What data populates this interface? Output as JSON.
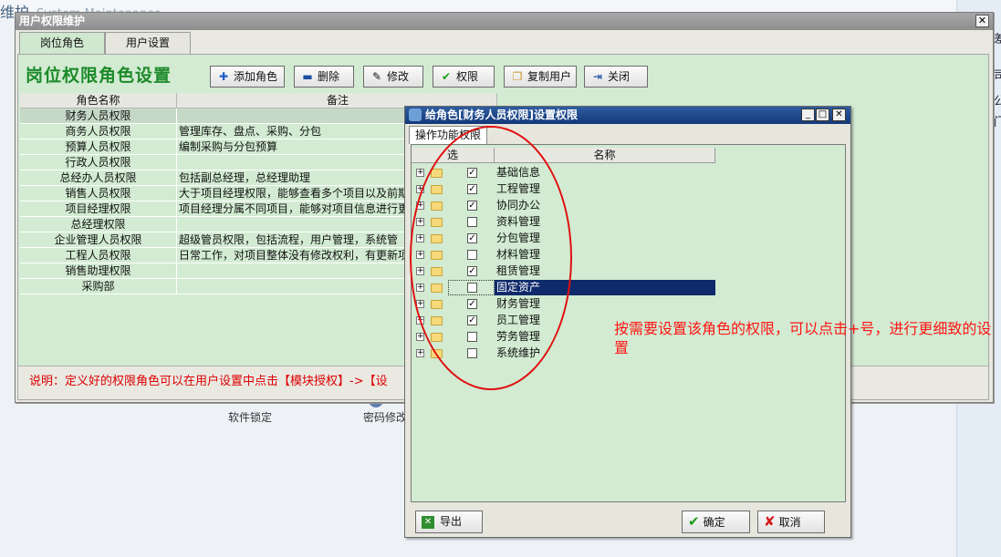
{
  "background": {
    "title": "维护",
    "subtitle": "System Maintenance",
    "links": [
      "软件锁定",
      "密码修改"
    ],
    "right_fragments": [
      "差",
      "司",
      "公",
      "门"
    ]
  },
  "main_window": {
    "title": "用户权限维护",
    "close_label": "✕",
    "tabs": [
      {
        "label": "岗位角色"
      },
      {
        "label": "用户设置"
      }
    ],
    "heading": "岗位权限角色设置",
    "toolbar": [
      {
        "label": "添加角色",
        "icon": "plus-icon"
      },
      {
        "label": "删除",
        "icon": "minus-icon"
      },
      {
        "label": "修改",
        "icon": "edit-icon"
      },
      {
        "label": "权限",
        "icon": "check-icon"
      },
      {
        "label": "复制用户",
        "icon": "copy-icon"
      },
      {
        "label": "关闭",
        "icon": "exit-icon"
      }
    ],
    "grid": {
      "columns": [
        "角色名称",
        "备注"
      ],
      "rows": [
        {
          "name": "财务人员权限",
          "note": ""
        },
        {
          "name": "商务人员权限",
          "note": "管理库存、盘点、采购、分包"
        },
        {
          "name": "预算人员权限",
          "note": "编制采购与分包预算"
        },
        {
          "name": "行政人员权限",
          "note": ""
        },
        {
          "name": "总经办人员权限",
          "note": "包括副总经理，总经理助理"
        },
        {
          "name": "销售人员权限",
          "note": "大于项目经理权限，能够查看多个项目以及前期"
        },
        {
          "name": "项目经理权限",
          "note": "项目经理分属不同项目，能够对项目信息进行更"
        },
        {
          "name": "总经理权限",
          "note": ""
        },
        {
          "name": "企业管理人员权限",
          "note": "超级管员权限，包括流程，用户管理，系统管"
        },
        {
          "name": "工程人员权限",
          "note": "日常工作，对项目整体没有修改权利，有更新项"
        },
        {
          "name": "销售助理权限",
          "note": ""
        },
        {
          "name": "采购部",
          "note": ""
        }
      ]
    },
    "status_text": "说明：定义好的权限角色可以在用户设置中点击【模块授权】->【设"
  },
  "dialog": {
    "title": "给角色[财务人员权限]设置权限",
    "window_buttons": {
      "minimize": "_",
      "maximize": "□",
      "close": "✕"
    },
    "tab_label": "操作功能权限",
    "columns": [
      "选",
      "名称"
    ],
    "items": [
      {
        "label": "基础信息",
        "checked": true,
        "mark": "✓"
      },
      {
        "label": "工程管理",
        "checked": true,
        "mark": "✓"
      },
      {
        "label": "协同办公",
        "checked": true,
        "mark": "✓"
      },
      {
        "label": "资料管理",
        "checked": false,
        "mark": ""
      },
      {
        "label": "分包管理",
        "checked": true,
        "mark": "✓"
      },
      {
        "label": "材料管理",
        "checked": false,
        "mark": ""
      },
      {
        "label": "租赁管理",
        "checked": true,
        "mark": "✓"
      },
      {
        "label": "固定资产",
        "checked": false,
        "mark": "",
        "selected": true
      },
      {
        "label": "财务管理",
        "checked": true,
        "mark": "✓"
      },
      {
        "label": "员工管理",
        "checked": true,
        "mark": "✓"
      },
      {
        "label": "劳务管理",
        "checked": false,
        "mark": ""
      },
      {
        "label": "系统维护",
        "checked": false,
        "mark": ""
      }
    ],
    "buttons": {
      "export": "导出",
      "ok": "确定",
      "cancel": "取消"
    }
  },
  "annotation": "按需要设置该角色的权限，可以点击+号，进行更细致的设置",
  "colors": {
    "panel_green": "#d2ebd2",
    "heading_green": "#1d8a2a",
    "dialog_title_blue": "#13387a",
    "selection_blue": "#0f2a6b",
    "annotation_red": "#ff1414"
  }
}
